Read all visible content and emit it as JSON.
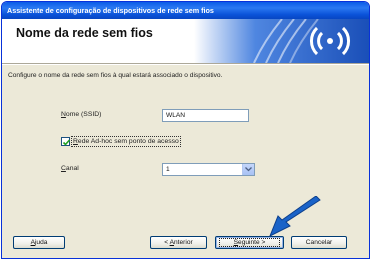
{
  "window": {
    "title": "Assistente de configuração de dispositivos de rede sem fios"
  },
  "header": {
    "title": "Nome da rede sem fios",
    "banner_icon": "wireless-signal-icon",
    "banner_color": "#1f5fd0"
  },
  "instruction": "Configure o nome da rede sem fios à qual estará associado o dispositivo.",
  "form": {
    "ssid_label": "Nome (SSID)",
    "ssid_value": "WLAN",
    "adhoc_label": "Rede Ad-hoc sem ponto de acesso",
    "adhoc_checked": true,
    "channel_label": "Canal",
    "channel_value": "1"
  },
  "buttons": {
    "help": "Ajuda",
    "back": "< Anterior",
    "next": "Seguinte >",
    "cancel": "Cancelar"
  },
  "annotation": {
    "arrow_color": "#1a63c8",
    "arrow_icon": "pointer-arrow-icon"
  }
}
